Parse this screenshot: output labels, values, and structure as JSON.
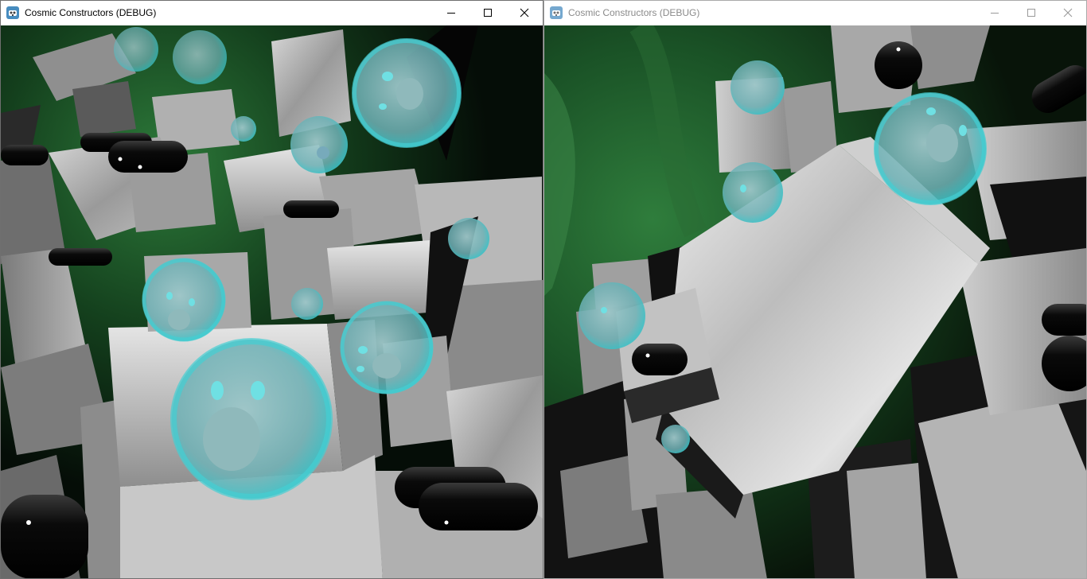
{
  "colors": {
    "titlebar_bg": "#ffffff",
    "title_active": "#000000",
    "title_inactive": "#8a8a8a",
    "nebula_green": "#1f5a2a",
    "bubble_cyan": "#5fd3d6",
    "cube_gray": "#a8a8a8",
    "capsule_black": "#0a0a0a"
  },
  "windows": [
    {
      "title": "Cosmic Constructors (DEBUG)",
      "state": "active",
      "icon": "godot-engine-icon",
      "controls": [
        "minimize-icon",
        "maximize-icon",
        "close-icon"
      ],
      "viewport": "game-viewport"
    },
    {
      "title": "Cosmic Constructors (DEBUG)",
      "state": "inactive",
      "icon": "godot-engine-icon",
      "controls": [
        "minimize-icon",
        "maximize-icon",
        "close-icon"
      ],
      "viewport": "game-viewport"
    }
  ]
}
